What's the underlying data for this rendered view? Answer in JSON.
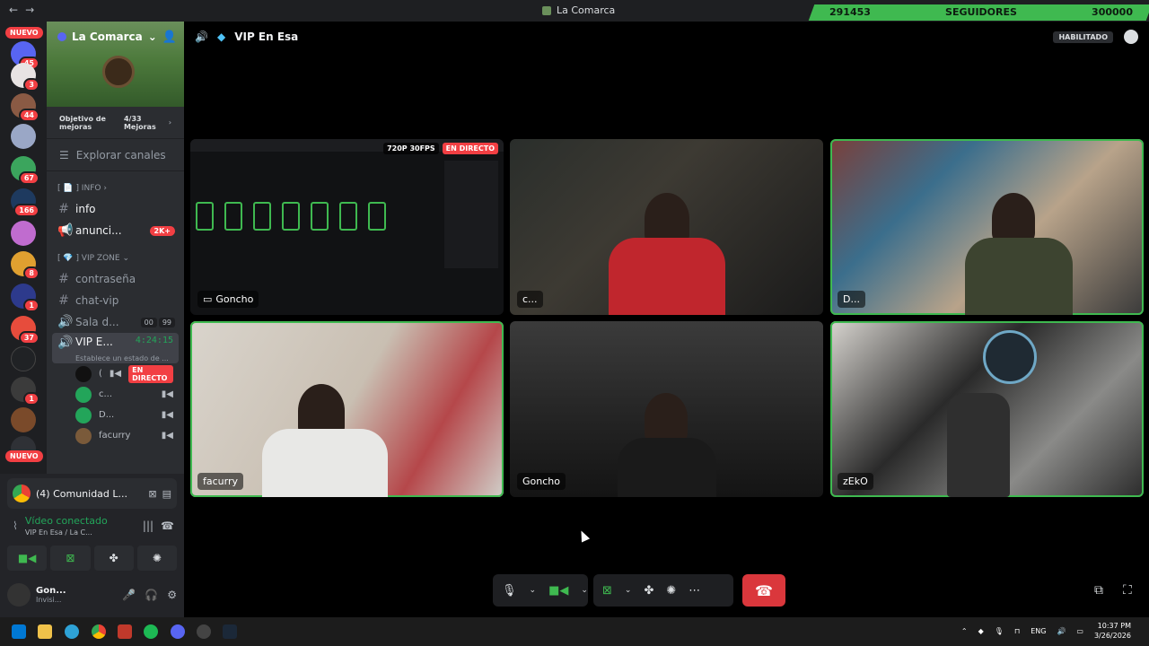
{
  "titlebar": {
    "title": "La Comarca",
    "nav_back": "←",
    "nav_fwd": "→"
  },
  "followers": {
    "current": "291453",
    "label": "SEGUIDORES",
    "goal": "300000"
  },
  "guilds": {
    "new_label_top": "NUEVO",
    "new_label_bottom": "NUEVO",
    "badges": [
      "45",
      "3",
      "44",
      "67",
      "166",
      "8",
      "1",
      "37",
      "1"
    ]
  },
  "server": {
    "name": "La Comarca",
    "boost_label": "Objetivo de mejoras",
    "boost_count": "4/33",
    "boost_unit": "Mejoras",
    "explore": "Explorar canales",
    "category_info": "[ 📄 ] INFO",
    "category_vip": "[ 💎 ] VIP ZONE"
  },
  "channels": [
    {
      "name": "info",
      "symbol": "#"
    },
    {
      "name": "anunci...",
      "symbol": "📢",
      "badge": "2K+"
    },
    {
      "name": "contraseña",
      "symbol": "#"
    },
    {
      "name": "chat-vip",
      "symbol": "#"
    },
    {
      "name": "Sala d...",
      "symbol": "🔊",
      "count_a": "00",
      "count_b": "99"
    },
    {
      "name": "VIP E...",
      "symbol": "🔊",
      "timer": "4:24:15",
      "status": "Establece un estado de ..."
    }
  ],
  "voice_users": [
    {
      "name": "(",
      "live": "EN DIRECTO"
    },
    {
      "name": "c..."
    },
    {
      "name": "D..."
    },
    {
      "name": "facurry"
    }
  ],
  "panel": {
    "notif": "(4) Comunidad L...",
    "voice_status": "Vídeo conectado",
    "voice_channel": "VIP En Esa / La C...",
    "username": "Gon...",
    "user_status": "Invisi..."
  },
  "channel_header": {
    "name": "VIP En Esa",
    "enabled": "HABILITADO"
  },
  "tiles": [
    {
      "name": "Goncho",
      "quality": "720P 30FPS",
      "live": "EN DIRECTO",
      "kind": "screen"
    },
    {
      "name": "c...",
      "kind": "cam"
    },
    {
      "name": "D...",
      "kind": "cam"
    },
    {
      "name": "facurry",
      "kind": "cam"
    },
    {
      "name": "Goncho",
      "kind": "cam"
    },
    {
      "name": "zEkO",
      "kind": "cam"
    }
  ],
  "taskbar": {
    "lang": "ENG",
    "time": "10:37 PM",
    "date": "3/26/2026"
  },
  "colors": {
    "accent_green": "#3fb950",
    "danger": "#da373c",
    "live_red": "#f23f43"
  }
}
